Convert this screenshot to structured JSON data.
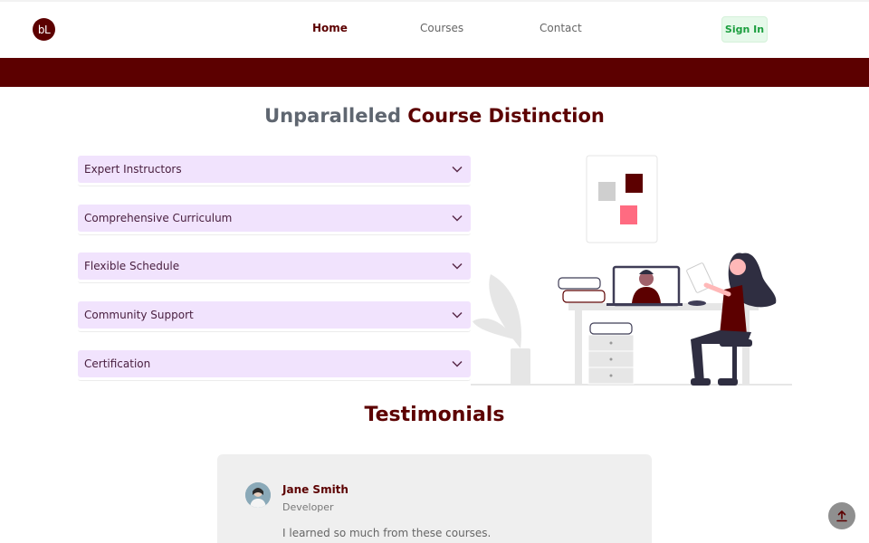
{
  "navbar": {
    "logo_text": "bL",
    "links": [
      {
        "label": "Home",
        "active": true
      },
      {
        "label": "Courses",
        "active": false
      },
      {
        "label": "Contact",
        "active": false
      }
    ],
    "signin_label": "Sign In"
  },
  "features": {
    "title_part1": "Unparalleled",
    "title_part2": "Course Distinction",
    "items": [
      {
        "label": "Expert Instructors",
        "icon": "chevron-down-icon"
      },
      {
        "label": "Comprehensive Curriculum",
        "icon": "chevron-down-icon"
      },
      {
        "label": "Flexible Schedule",
        "icon": "chevron-down-icon"
      },
      {
        "label": "Community Support",
        "icon": "chevron-down-icon"
      },
      {
        "label": "Certification",
        "icon": "chevron-down-icon"
      }
    ]
  },
  "testimonials": {
    "title": "Testimonials",
    "items": [
      {
        "name": "Jane Smith",
        "role": "Developer",
        "quote": "I learned so much from these courses."
      }
    ]
  },
  "colors": {
    "brand": "#5c0000",
    "accordion_bg": "#f1e3fd",
    "signin_bg": "#e6f9ea",
    "signin_text": "#1b9e3e",
    "accent_pink": "#ff6b81"
  },
  "icons": {
    "scroll_top": "arrow-up-icon"
  }
}
